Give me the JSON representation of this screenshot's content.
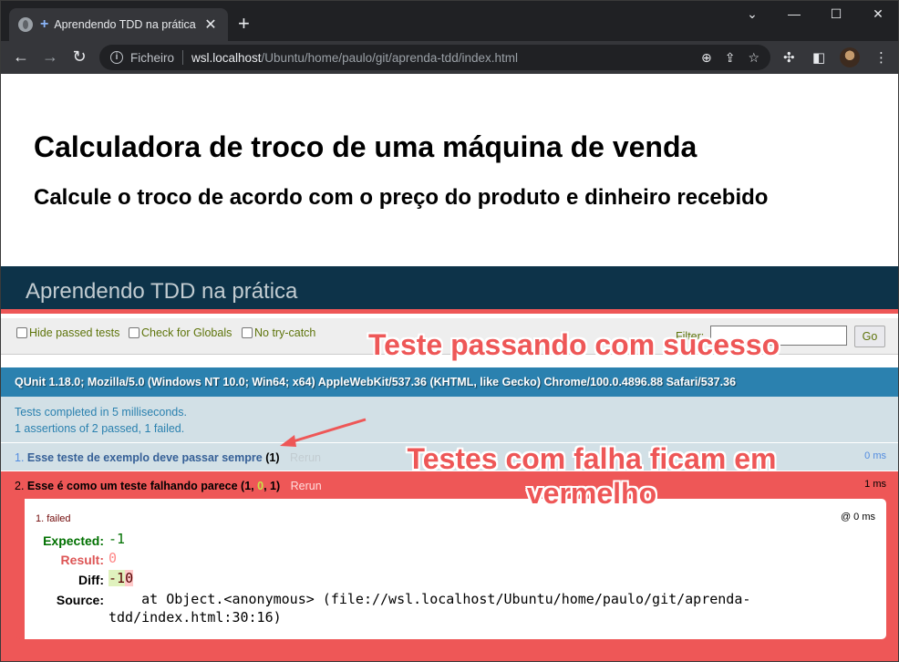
{
  "browser": {
    "tab_title": "Aprendendo TDD na prática",
    "tab_close": "✕",
    "new_tab": "+",
    "window_controls": [
      "⌄",
      "—",
      "☐",
      "✕"
    ],
    "omnibox": {
      "scheme_label": "Ficheiro",
      "host": "wsl.localhost",
      "path": "/Ubuntu/home/paulo/git/aprenda-tdd/index.html"
    }
  },
  "page": {
    "h1": "Calculadora de troco de uma máquina de venda",
    "h2": "Calcule o troco de acordo com o preço do produto e dinheiro recebido"
  },
  "qunit": {
    "header": "Aprendendo TDD na prática",
    "toolbar": {
      "hide_passed": "Hide passed tests",
      "check_globals": "Check for Globals",
      "no_try_catch": "No try-catch",
      "filter_label": "Filter:",
      "go_label": "Go"
    },
    "user_agent": "QUnit 1.18.0; Mozilla/5.0 (Windows NT 10.0; Win64; x64) AppleWebKit/537.36 (KHTML, like Gecko) Chrome/100.0.4896.88 Safari/537.36",
    "testresult": {
      "line1": "Tests completed in 5 milliseconds.",
      "line2": "1 assertions of 2 passed, 1 failed."
    },
    "tests": [
      {
        "index": "1.",
        "name": "Esse teste de exemplo deve passar sempre",
        "count": "(1)",
        "rerun": "Rerun",
        "runtime": "0 ms"
      },
      {
        "index": "2.",
        "name": "Esse é como um teste falhando parece",
        "count_open": "(1, ",
        "count_zero": "0",
        "count_close": ", 1)",
        "rerun": "Rerun",
        "runtime": "1 ms",
        "assertion": {
          "label": "1. failed",
          "runtime": "@ 0 ms",
          "expected_label": "Expected:",
          "expected": "-1",
          "result_label": "Result:",
          "result": "0",
          "diff_label": "Diff:",
          "diff_ins": "-1",
          "diff_del": "0",
          "source_label": "Source:",
          "source": "    at Object.<anonymous> (file://wsl.localhost/Ubuntu/home/paulo/git/aprenda-\ntdd/index.html:30:16)"
        }
      }
    ]
  },
  "annotations": {
    "pass": "Teste passando com sucesso",
    "fail": "Testes com falha ficam em vermelho"
  },
  "colors": {
    "qunit_header_bg": "#0d3349",
    "fail_red": "#ee5757",
    "ua_blue": "#2b81af"
  }
}
